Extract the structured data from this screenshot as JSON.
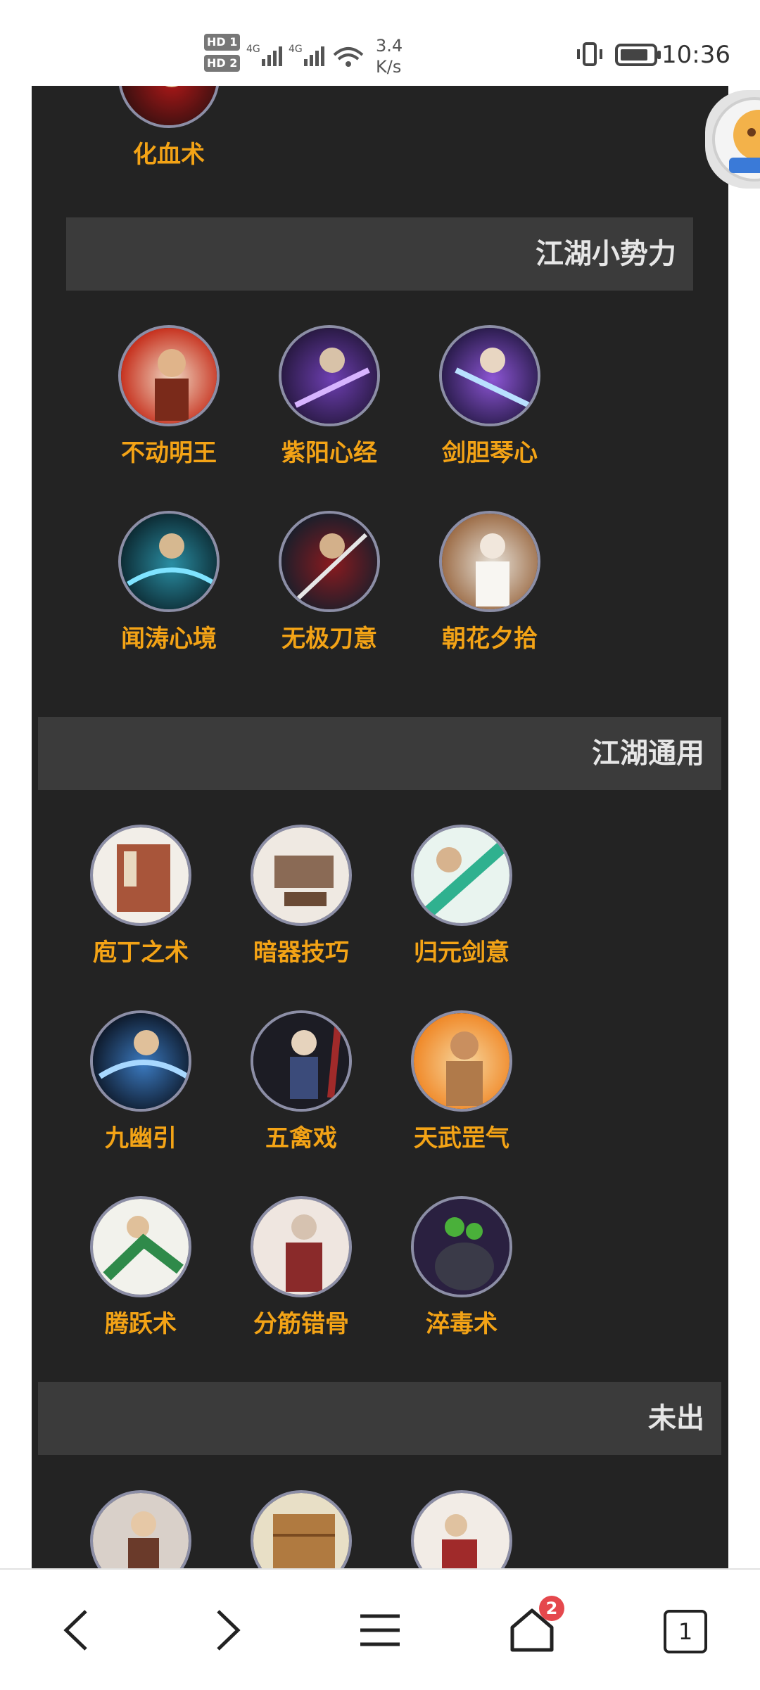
{
  "status_bar": {
    "hd1": "HD 1",
    "hd2": "HD 2",
    "net1": "4G",
    "net2": "4G",
    "speed_value": "3.4",
    "speed_unit": "K/s",
    "time": "10:36"
  },
  "top_item": {
    "label": "化血术",
    "colors": [
      "#b01818",
      "#3a1010"
    ]
  },
  "sections": [
    {
      "title": "江湖小势力",
      "items": [
        {
          "label": "不动明王",
          "colors": [
            "#c73320",
            "#f0d9c4"
          ]
        },
        {
          "label": "紫阳心经",
          "colors": [
            "#6e3fb2",
            "#2a1a45"
          ]
        },
        {
          "label": "剑胆琴心",
          "colors": [
            "#8c55d4",
            "#2c1d4f"
          ]
        },
        {
          "label": "闻涛心境",
          "colors": [
            "#2a8ea3",
            "#0d2d36"
          ]
        },
        {
          "label": "无极刀意",
          "colors": [
            "#8a1a1f",
            "#1e1e2a"
          ]
        },
        {
          "label": "朝花夕拾",
          "colors": [
            "#e7e2d9",
            "#9e6f4a"
          ]
        }
      ]
    },
    {
      "title": "江湖通用",
      "items": [
        {
          "label": "庖丁之术",
          "colors": [
            "#a8553a",
            "#f2eee8"
          ]
        },
        {
          "label": "暗器技巧",
          "colors": [
            "#8a6a55",
            "#efe9e2"
          ]
        },
        {
          "label": "归元剑意",
          "colors": [
            "#2fb18f",
            "#e9f4ef"
          ]
        },
        {
          "label": "九幽引",
          "colors": [
            "#3b7ac0",
            "#0f1c2f"
          ]
        },
        {
          "label": "五禽戏",
          "colors": [
            "#3b4b7a",
            "#1c1c24"
          ]
        },
        {
          "label": "天武罡气",
          "colors": [
            "#f08a2a",
            "#f7d7a0"
          ]
        },
        {
          "label": "腾跃术",
          "colors": [
            "#2f8a4a",
            "#f2f2ec"
          ]
        },
        {
          "label": "分筋错骨",
          "colors": [
            "#8a2a2a",
            "#efe6e0"
          ]
        },
        {
          "label": "淬毒术",
          "colors": [
            "#4ab03a",
            "#2a2040"
          ]
        }
      ]
    },
    {
      "title": "未出",
      "items": [
        {
          "label": "",
          "colors": [
            "#6a3a2a",
            "#d9d0c9"
          ]
        },
        {
          "label": "",
          "colors": [
            "#b07a40",
            "#e8dfc6"
          ]
        },
        {
          "label": "",
          "colors": [
            "#a02a2a",
            "#f2ece6"
          ]
        }
      ]
    }
  ],
  "nav": {
    "back_icon": "chevron-left-icon",
    "forward_icon": "chevron-right-icon",
    "menu_icon": "menu-icon",
    "home_icon": "home-icon",
    "home_badge": "2",
    "tabs_count": "1"
  }
}
